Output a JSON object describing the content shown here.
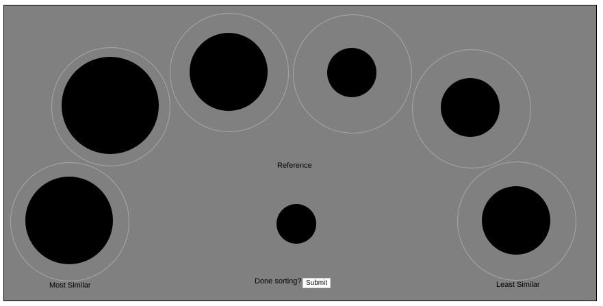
{
  "labels": {
    "reference": "Reference",
    "most_similar": "Most Similar",
    "least_similar": "Least Similar",
    "done_prompt": "Done sorting?",
    "submit": "Submit"
  },
  "colors": {
    "background": "#808080",
    "disc": "#000000",
    "slot_ring": "#a7a7a7",
    "border": "#000000"
  }
}
